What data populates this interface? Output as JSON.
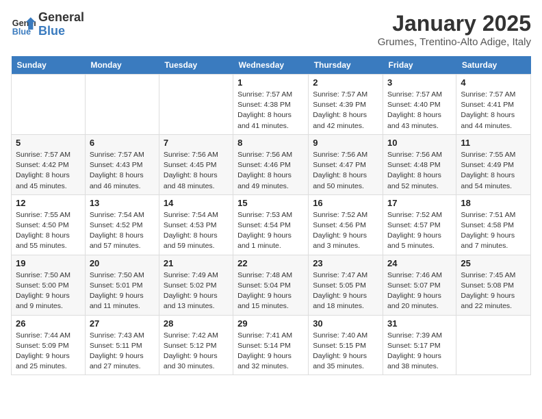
{
  "header": {
    "logo_line1": "General",
    "logo_line2": "Blue",
    "month": "January 2025",
    "location": "Grumes, Trentino-Alto Adige, Italy"
  },
  "weekdays": [
    "Sunday",
    "Monday",
    "Tuesday",
    "Wednesday",
    "Thursday",
    "Friday",
    "Saturday"
  ],
  "weeks": [
    [
      {
        "day": "",
        "info": ""
      },
      {
        "day": "",
        "info": ""
      },
      {
        "day": "",
        "info": ""
      },
      {
        "day": "1",
        "info": "Sunrise: 7:57 AM\nSunset: 4:38 PM\nDaylight: 8 hours and 41 minutes."
      },
      {
        "day": "2",
        "info": "Sunrise: 7:57 AM\nSunset: 4:39 PM\nDaylight: 8 hours and 42 minutes."
      },
      {
        "day": "3",
        "info": "Sunrise: 7:57 AM\nSunset: 4:40 PM\nDaylight: 8 hours and 43 minutes."
      },
      {
        "day": "4",
        "info": "Sunrise: 7:57 AM\nSunset: 4:41 PM\nDaylight: 8 hours and 44 minutes."
      }
    ],
    [
      {
        "day": "5",
        "info": "Sunrise: 7:57 AM\nSunset: 4:42 PM\nDaylight: 8 hours and 45 minutes."
      },
      {
        "day": "6",
        "info": "Sunrise: 7:57 AM\nSunset: 4:43 PM\nDaylight: 8 hours and 46 minutes."
      },
      {
        "day": "7",
        "info": "Sunrise: 7:56 AM\nSunset: 4:45 PM\nDaylight: 8 hours and 48 minutes."
      },
      {
        "day": "8",
        "info": "Sunrise: 7:56 AM\nSunset: 4:46 PM\nDaylight: 8 hours and 49 minutes."
      },
      {
        "day": "9",
        "info": "Sunrise: 7:56 AM\nSunset: 4:47 PM\nDaylight: 8 hours and 50 minutes."
      },
      {
        "day": "10",
        "info": "Sunrise: 7:56 AM\nSunset: 4:48 PM\nDaylight: 8 hours and 52 minutes."
      },
      {
        "day": "11",
        "info": "Sunrise: 7:55 AM\nSunset: 4:49 PM\nDaylight: 8 hours and 54 minutes."
      }
    ],
    [
      {
        "day": "12",
        "info": "Sunrise: 7:55 AM\nSunset: 4:50 PM\nDaylight: 8 hours and 55 minutes."
      },
      {
        "day": "13",
        "info": "Sunrise: 7:54 AM\nSunset: 4:52 PM\nDaylight: 8 hours and 57 minutes."
      },
      {
        "day": "14",
        "info": "Sunrise: 7:54 AM\nSunset: 4:53 PM\nDaylight: 8 hours and 59 minutes."
      },
      {
        "day": "15",
        "info": "Sunrise: 7:53 AM\nSunset: 4:54 PM\nDaylight: 9 hours and 1 minute."
      },
      {
        "day": "16",
        "info": "Sunrise: 7:52 AM\nSunset: 4:56 PM\nDaylight: 9 hours and 3 minutes."
      },
      {
        "day": "17",
        "info": "Sunrise: 7:52 AM\nSunset: 4:57 PM\nDaylight: 9 hours and 5 minutes."
      },
      {
        "day": "18",
        "info": "Sunrise: 7:51 AM\nSunset: 4:58 PM\nDaylight: 9 hours and 7 minutes."
      }
    ],
    [
      {
        "day": "19",
        "info": "Sunrise: 7:50 AM\nSunset: 5:00 PM\nDaylight: 9 hours and 9 minutes."
      },
      {
        "day": "20",
        "info": "Sunrise: 7:50 AM\nSunset: 5:01 PM\nDaylight: 9 hours and 11 minutes."
      },
      {
        "day": "21",
        "info": "Sunrise: 7:49 AM\nSunset: 5:02 PM\nDaylight: 9 hours and 13 minutes."
      },
      {
        "day": "22",
        "info": "Sunrise: 7:48 AM\nSunset: 5:04 PM\nDaylight: 9 hours and 15 minutes."
      },
      {
        "day": "23",
        "info": "Sunrise: 7:47 AM\nSunset: 5:05 PM\nDaylight: 9 hours and 18 minutes."
      },
      {
        "day": "24",
        "info": "Sunrise: 7:46 AM\nSunset: 5:07 PM\nDaylight: 9 hours and 20 minutes."
      },
      {
        "day": "25",
        "info": "Sunrise: 7:45 AM\nSunset: 5:08 PM\nDaylight: 9 hours and 22 minutes."
      }
    ],
    [
      {
        "day": "26",
        "info": "Sunrise: 7:44 AM\nSunset: 5:09 PM\nDaylight: 9 hours and 25 minutes."
      },
      {
        "day": "27",
        "info": "Sunrise: 7:43 AM\nSunset: 5:11 PM\nDaylight: 9 hours and 27 minutes."
      },
      {
        "day": "28",
        "info": "Sunrise: 7:42 AM\nSunset: 5:12 PM\nDaylight: 9 hours and 30 minutes."
      },
      {
        "day": "29",
        "info": "Sunrise: 7:41 AM\nSunset: 5:14 PM\nDaylight: 9 hours and 32 minutes."
      },
      {
        "day": "30",
        "info": "Sunrise: 7:40 AM\nSunset: 5:15 PM\nDaylight: 9 hours and 35 minutes."
      },
      {
        "day": "31",
        "info": "Sunrise: 7:39 AM\nSunset: 5:17 PM\nDaylight: 9 hours and 38 minutes."
      },
      {
        "day": "",
        "info": ""
      }
    ]
  ]
}
